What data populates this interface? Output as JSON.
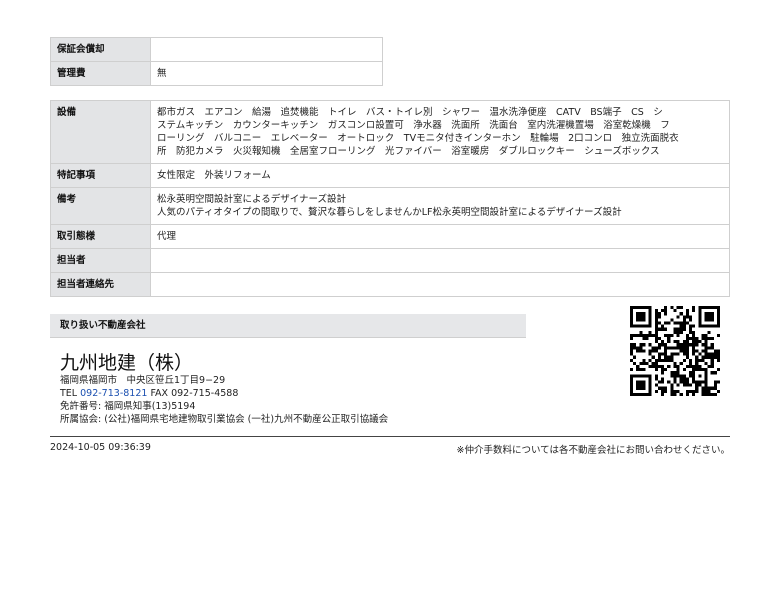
{
  "top_rows": [
    {
      "key": "保証会償却",
      "value": ""
    },
    {
      "key": "管理費",
      "value": "無"
    }
  ],
  "equipment": {
    "key": "設備",
    "lines": [
      "都市ガス　エアコン　給湯　追焚機能　トイレ　バス・トイレ別　シャワー　温水洗浄便座　CATV　BS端子　CS　シ",
      "ステムキッチン　カウンターキッチン　ガスコンロ設置可　浄水器　洗面所　洗面台　室内洗濯機置場　浴室乾燥機　フ",
      "ローリング　バルコニー　エレベーター　オートロック　TVモニタ付きインターホン　駐輪場　2口コンロ　独立洗面脱衣",
      "所　防犯カメラ　火災報知機　全居室フローリング　光ファイバー　浴室暖房　ダブルロックキー　シューズボックス"
    ]
  },
  "special": {
    "key": "特記事項",
    "value": "女性限定　外装リフォーム"
  },
  "remarks": {
    "key": "備考",
    "lines": [
      "松永英明空間設計室によるデザイナーズ設計",
      "人気のパティオタイプの間取りで、贅沢な暮らしをしませんかLF松永英明空間設計室によるデザイナーズ設計"
    ]
  },
  "transaction": {
    "key": "取引態様",
    "value": "代理"
  },
  "staff": {
    "key": "担当者",
    "value": ""
  },
  "staff_contact": {
    "key": "担当者連絡先",
    "value": ""
  },
  "agency": {
    "section_title": "取り扱い不動産会社",
    "name": "九州地建（株）",
    "address": "福岡県福岡市　中央区笹丘1丁目9−29",
    "tel_label": "TEL ",
    "tel": "092-713-8121",
    "fax_label": " FAX ",
    "fax": "092-715-4588",
    "license": "免許番号: 福岡県知事(13)5194",
    "association": "所属協会: (公社)福岡県宅地建物取引業協会 (一社)九州不動産公正取引協議会"
  },
  "footer": {
    "timestamp": "2024-10-05 09:36:39",
    "note": "※仲介手数料については各不動産会社にお問い合わせください。"
  }
}
